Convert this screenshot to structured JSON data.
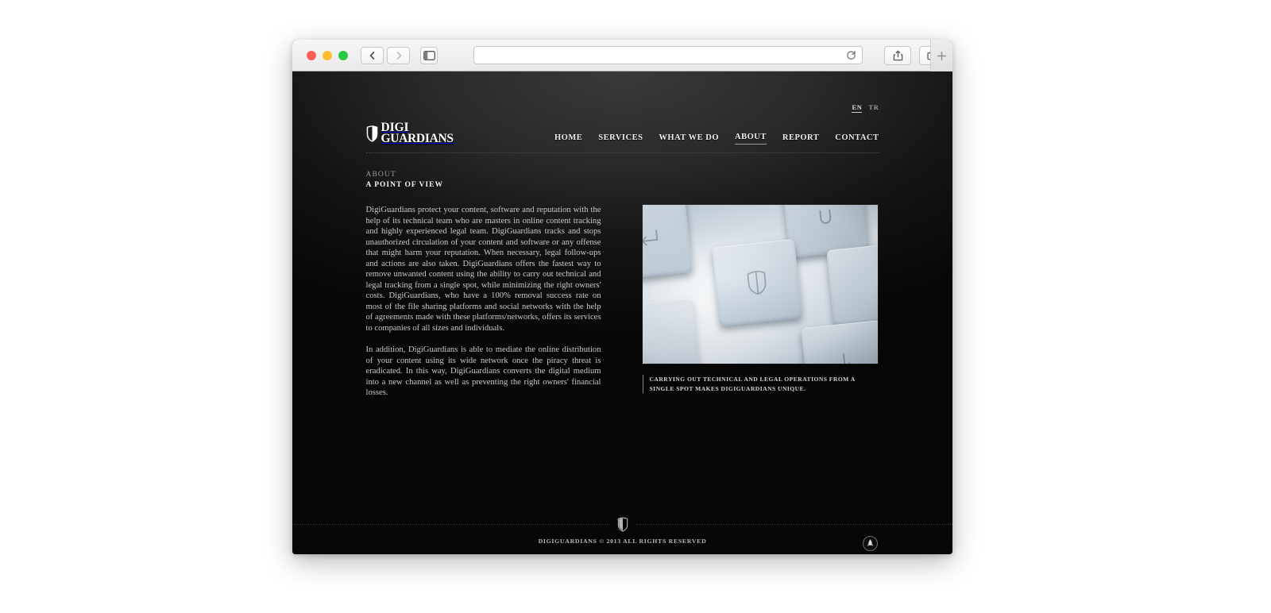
{
  "browser": {
    "traffic_lights": [
      "close",
      "minimize",
      "maximize"
    ],
    "back_label": "Back",
    "forward_label": "Forward",
    "sidebar_label": "Show Sidebar",
    "address_value": "",
    "address_placeholder": "",
    "reload_label": "Reload",
    "share_label": "Share",
    "tabs_label": "Show Tab Overview",
    "new_tab_label": "+"
  },
  "site": {
    "lang": {
      "active": "EN",
      "inactive": "TR"
    },
    "logo": {
      "line1": "DIGI",
      "line2": "GUARDIANS"
    },
    "nav": [
      {
        "label": "HOME",
        "active": false
      },
      {
        "label": "SERVICES",
        "active": false
      },
      {
        "label": "WHAT WE DO",
        "active": false
      },
      {
        "label": "ABOUT",
        "active": true
      },
      {
        "label": "REPORT",
        "active": false
      },
      {
        "label": "CONTACT",
        "active": false
      }
    ],
    "page": {
      "kicker": "ABOUT",
      "title": "A POINT OF VIEW",
      "paragraphs": [
        "DigiGuardians protect your content, software and reputation with the help of its technical team who are masters in online content tracking and highly experienced legal team. DigiGuardians tracks and stops unauthorized circulation of your content and software or any offense that might harm your reputation. When necessary, legal follow-ups and actions are also taken. DigiGuardians offers the fastest way to remove unwanted content using the ability to carry out technical and legal tracking from a single spot, while minimizing the right owners' costs. DigiGuardians, who have a 100% removal success rate on most of the file sharing platforms and social networks with the help of agreements made with these platforms/networks, offers its services to companies of all sizes and individuals.",
        "In addition, DigiGuardians is able to mediate the online distribution of your content using its wide network once the piracy threat is eradicated. In this way, DigiGuardians converts the digital medium into a new channel as well as preventing the right owners' financial losses."
      ],
      "image_alt": "keyboard-key-with-shield-symbol",
      "image_caption": "CARRYING OUT TECHNICAL AND LEGAL OPERATIONS FROM A SINGLE SPOT MAKES DIGIGUARDIANS UNIQUE."
    },
    "footer": {
      "copyright": "DIGIGUARDIANS © 2013 ALL RIGHTS RESERVED",
      "scroll_top_label": "Back to top"
    },
    "colors": {
      "background": "#060606",
      "header_gradient_top": "#3a3a3a",
      "text": "#c9c9c9",
      "heading": "#f4f4f4",
      "muted": "#9c9c9c",
      "rule": "#4b4b4b"
    }
  }
}
